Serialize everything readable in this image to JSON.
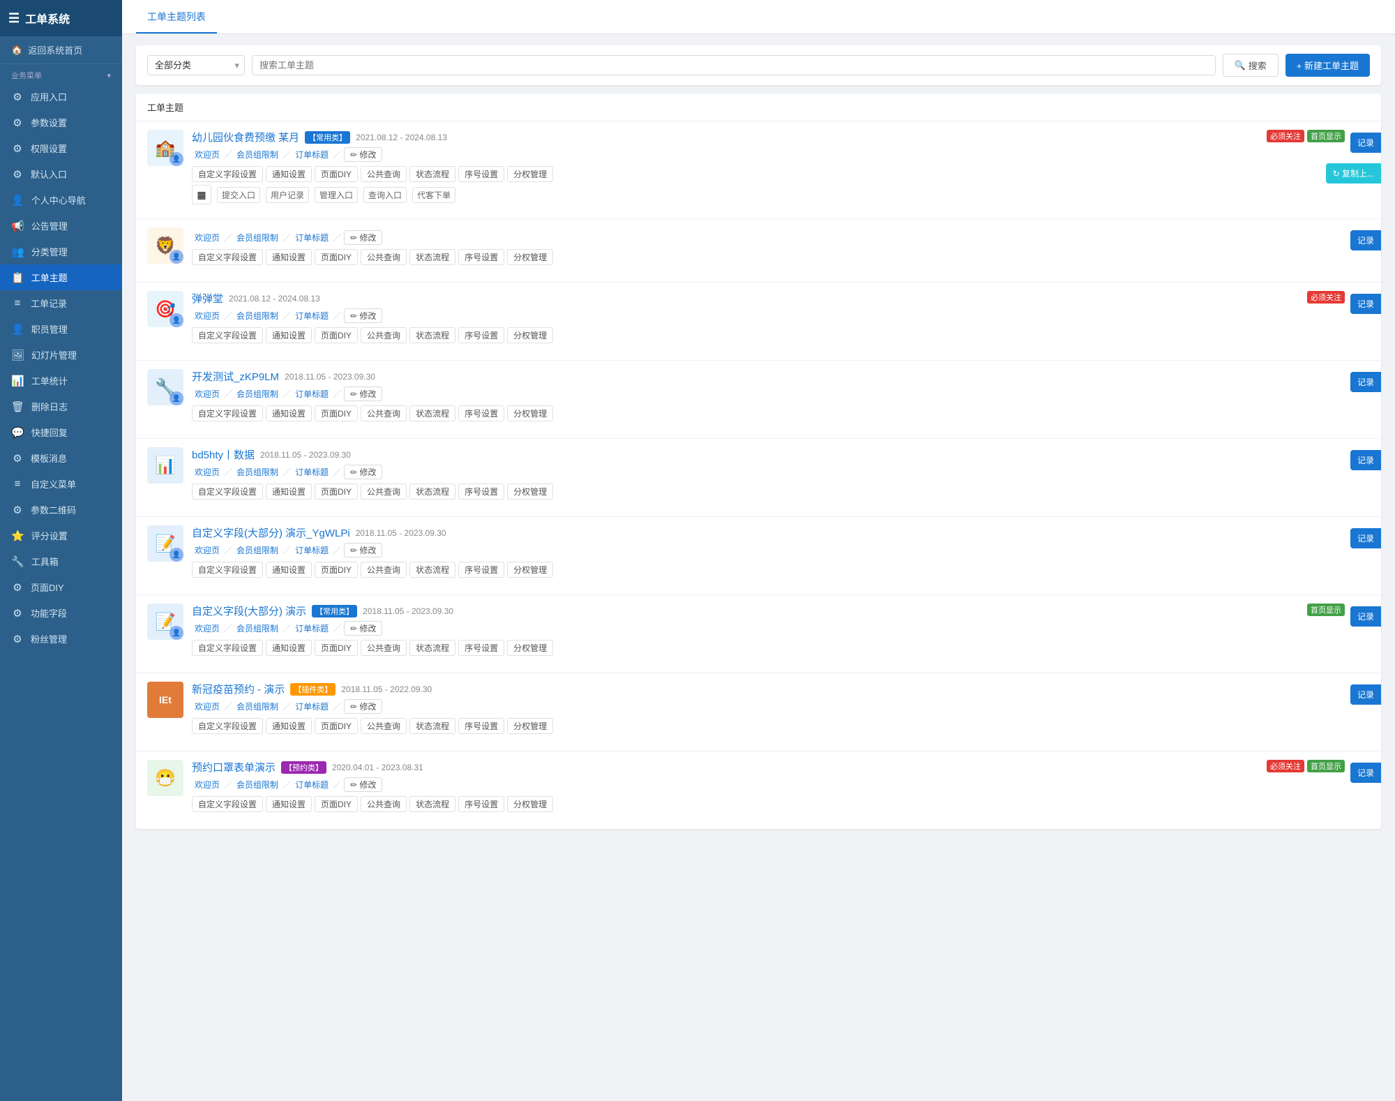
{
  "sidebar": {
    "title": "工单系统",
    "top_link": "返回系统首页",
    "section_label": "业务菜单",
    "items": [
      {
        "id": "app-entry",
        "icon": "⚙",
        "label": "应用入口"
      },
      {
        "id": "param-settings",
        "icon": "⚙",
        "label": "参数设置"
      },
      {
        "id": "permission-settings",
        "icon": "⚙",
        "label": "权限设置"
      },
      {
        "id": "default-entry",
        "icon": "⚙",
        "label": "默认入口"
      },
      {
        "id": "personal-nav",
        "icon": "👤",
        "label": "个人中心导航"
      },
      {
        "id": "notice-mgmt",
        "icon": "📢",
        "label": "公告管理"
      },
      {
        "id": "category-mgmt",
        "icon": "👥",
        "label": "分类管理"
      },
      {
        "id": "ticket-topic",
        "icon": "📋",
        "label": "工单主题",
        "active": true
      },
      {
        "id": "ticket-record",
        "icon": "≡",
        "label": "工单记录"
      },
      {
        "id": "staff-mgmt",
        "icon": "👤",
        "label": "职员管理"
      },
      {
        "id": "slideshow-mgmt",
        "icon": "🖼",
        "label": "幻灯片管理"
      },
      {
        "id": "ticket-stats",
        "icon": "📊",
        "label": "工单统计"
      },
      {
        "id": "delete-log",
        "icon": "🗑",
        "label": "删除日志"
      },
      {
        "id": "quick-reply",
        "icon": "💬",
        "label": "快捷回复"
      },
      {
        "id": "template-msg",
        "icon": "⚙",
        "label": "模板消息"
      },
      {
        "id": "custom-menu",
        "icon": "≡",
        "label": "自定义菜单"
      },
      {
        "id": "param-qr",
        "icon": "⚙",
        "label": "参数二维码"
      },
      {
        "id": "rating-settings",
        "icon": "⭐",
        "label": "评分设置"
      },
      {
        "id": "toolbox",
        "icon": "🔧",
        "label": "工具箱"
      },
      {
        "id": "page-diy",
        "icon": "⚙",
        "label": "页面DIY"
      },
      {
        "id": "func-field",
        "icon": "⚙",
        "label": "功能字段"
      },
      {
        "id": "fan-mgmt",
        "icon": "⚙",
        "label": "粉丝管理"
      }
    ]
  },
  "tabs": [
    {
      "id": "topic-list",
      "label": "工单主题列表",
      "active": true
    }
  ],
  "filter": {
    "category_placeholder": "全部分类",
    "search_placeholder": "搜索工单主题",
    "search_btn": "搜索",
    "new_btn": "+ 新建工单主题"
  },
  "table": {
    "header": "工单主题",
    "topics": [
      {
        "id": 1,
        "thumb_color": "#e8f4fc",
        "thumb_icon": "🏫",
        "title": "幼儿园伙食费预缴 某月",
        "tags": [
          {
            "text": "常用类",
            "type": "common"
          }
        ],
        "badges": [
          {
            "text": "必须关注",
            "type": "must-follow"
          },
          {
            "text": "首页显示",
            "type": "home-display"
          }
        ],
        "date": "2021.08.12 - 2024.08.13",
        "links": [
          "欢迎页",
          "会员组限制",
          "订单标题"
        ],
        "settings": [
          "自定义字段设置",
          "通知设置",
          "页面DIY",
          "公共查询",
          "状态流程",
          "序号设置",
          "分权管理"
        ],
        "bottom": [
          "提交入口",
          "用户记录",
          "管理入口",
          "查询入口",
          "代客下单"
        ],
        "has_qr": true,
        "has_copy": true,
        "record_btn": "记录"
      },
      {
        "id": 2,
        "thumb_color": "#fdf5e6",
        "thumb_icon": "🦁",
        "title": "",
        "tags": [],
        "badges": [],
        "date": "",
        "links": [
          "欢迎页",
          "会员组限制",
          "订单标题"
        ],
        "settings": [
          "自定义字段设置",
          "通知设置",
          "页面DIY",
          "公共查询",
          "状态流程",
          "序号设置",
          "分权管理"
        ],
        "bottom": [],
        "has_qr": false,
        "has_copy": false,
        "record_btn": "记录"
      },
      {
        "id": 3,
        "thumb_color": "#e8f4fc",
        "thumb_icon": "🎯",
        "title": "弹弹堂",
        "tags": [],
        "badges": [
          {
            "text": "必须关注",
            "type": "must-follow"
          }
        ],
        "date": "2021.08.12 - 2024.08.13",
        "links": [
          "欢迎页",
          "会员组限制",
          "订单标题"
        ],
        "settings": [
          "自定义字段设置",
          "通知设置",
          "页面DIY",
          "公共查询",
          "状态流程",
          "序号设置",
          "分权管理"
        ],
        "bottom": [],
        "has_qr": false,
        "has_copy": false,
        "record_btn": "记录"
      },
      {
        "id": 4,
        "thumb_color": "#e3f0fb",
        "thumb_icon": "🔧",
        "title": "开发测试_zKP9LM",
        "tags": [],
        "badges": [],
        "date": "2018.11.05 - 2023.09.30",
        "links": [
          "欢迎页",
          "会员组限制",
          "订单标题"
        ],
        "settings": [
          "自定义字段设置",
          "通知设置",
          "页面DIY",
          "公共查询",
          "状态流程",
          "序号设置",
          "分权管理"
        ],
        "bottom": [],
        "has_qr": false,
        "has_copy": false,
        "record_btn": "记录"
      },
      {
        "id": 5,
        "thumb_color": "#e3f0fb",
        "thumb_icon": "📊",
        "title": "bd5hty丨数据",
        "tags": [],
        "badges": [],
        "date": "2018.11.05 - 2023.09.30",
        "links": [
          "欢迎页",
          "会员组限制",
          "订单标题"
        ],
        "settings": [
          "自定义字段设置",
          "通知设置",
          "页面DIY",
          "公共查询",
          "状态流程",
          "序号设置",
          "分权管理"
        ],
        "bottom": [],
        "has_qr": false,
        "has_copy": false,
        "record_btn": "记录"
      },
      {
        "id": 6,
        "thumb_color": "#e3f0fb",
        "thumb_icon": "📝",
        "title": "自定义字段(大部分) 演示_YgWLPi",
        "tags": [],
        "badges": [],
        "date": "2018.11.05 - 2023.09.30",
        "links": [
          "欢迎页",
          "会员组限制",
          "订单标题"
        ],
        "settings": [
          "自定义字段设置",
          "通知设置",
          "页面DIY",
          "公共查询",
          "状态流程",
          "序号设置",
          "分权管理"
        ],
        "bottom": [],
        "has_qr": false,
        "has_copy": false,
        "record_btn": "记录"
      },
      {
        "id": 7,
        "thumb_color": "#e3f0fb",
        "thumb_icon": "📝",
        "title": "自定义字段(大部分) 演示",
        "tags": [
          {
            "text": "常用类",
            "type": "common"
          }
        ],
        "badges": [
          {
            "text": "首页显示",
            "type": "home-display"
          }
        ],
        "date": "2018.11.05 - 2023.09.30",
        "links": [
          "欢迎页",
          "会员组限制",
          "订单标题"
        ],
        "settings": [
          "自定义字段设置",
          "通知设置",
          "页面DIY",
          "公共查询",
          "状态流程",
          "序号设置",
          "分权管理"
        ],
        "bottom": [],
        "has_qr": false,
        "has_copy": false,
        "record_btn": "记录"
      },
      {
        "id": 8,
        "thumb_color": "#fff3e0",
        "thumb_icon": "💉",
        "thumb_text": "IEt",
        "title": "新冠疫苗预约 - 演示",
        "tags": [
          {
            "text": "插件类",
            "type": "plugin"
          }
        ],
        "badges": [],
        "date": "2018.11.05 - 2022.09.30",
        "links": [
          "欢迎页",
          "会员组限制",
          "订单标题"
        ],
        "settings": [
          "自定义字段设置",
          "通知设置",
          "页面DIY",
          "公共查询",
          "状态流程",
          "序号设置",
          "分权管理"
        ],
        "bottom": [],
        "has_qr": false,
        "has_copy": false,
        "record_btn": "记录"
      },
      {
        "id": 9,
        "thumb_color": "#e8f5e9",
        "thumb_icon": "😷",
        "title": "预约口罩表单演示",
        "tags": [
          {
            "text": "预约类",
            "type": "booking"
          }
        ],
        "badges": [
          {
            "text": "必须关注",
            "type": "must-follow"
          },
          {
            "text": "首页显示",
            "type": "home-display"
          }
        ],
        "date": "2020.04.01 - 2023.08.31",
        "links": [
          "欢迎页",
          "会员组限制",
          "订单标题"
        ],
        "settings": [
          "自定义字段设置",
          "通知设置",
          "页面DIY",
          "公共查询",
          "状态流程",
          "序号设置",
          "分权管理"
        ],
        "bottom": [],
        "has_qr": false,
        "has_copy": false,
        "record_btn": "记录"
      }
    ]
  }
}
